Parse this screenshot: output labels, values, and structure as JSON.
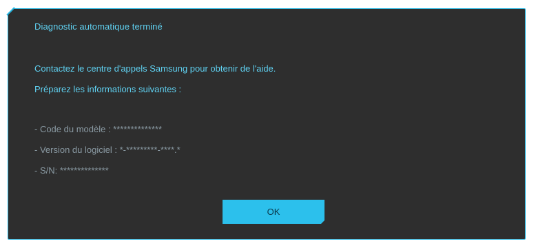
{
  "dialog": {
    "title": "Diagnostic automatique terminé",
    "lines": [
      "Contactez le centre d'appels Samsung pour obtenir de l'aide.",
      "Préparez les informations suivantes :",
      "- Code du modèle : **************",
      "- Version du logiciel : *-*********-****.*",
      "- S/N: **************"
    ],
    "ok_label": "OK"
  },
  "colors": {
    "background": "#2e2e2e",
    "border": "#24b5e0",
    "text_accent": "#5fd0f0",
    "text_muted": "#8a9aa3",
    "button": "#2cc0ec"
  }
}
